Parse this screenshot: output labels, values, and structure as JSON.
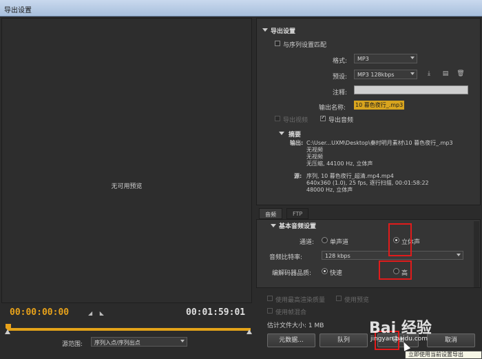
{
  "window": {
    "title": "导出设置"
  },
  "preview": {
    "no_preview": "无可用预览",
    "timecode_in": "00:00:00:00",
    "timecode_out": "00:01:59:01",
    "source_range_label": "源范围:",
    "source_range_value": "序列入点/序列出点"
  },
  "export_settings": {
    "header": "导出设置",
    "match_sequence_label": "与序列设置匹配",
    "format_label": "格式:",
    "format_value": "MP3",
    "preset_label": "预设:",
    "preset_value": "MP3 128kbps",
    "comment_label": "注释:",
    "comment_value": "",
    "output_name_label": "输出名称:",
    "output_name_value": "10 暮色夜行_.mp3",
    "export_video_label": "导出视频",
    "export_audio_label": "导出音频"
  },
  "summary": {
    "header": "摘要",
    "output_label": "输出:",
    "output_lines": [
      "C:\\User...UXM\\Desktop\\秦时明月素材\\10 暮色夜行_.mp3",
      "无视频",
      "无视频",
      "无压缩, 44100 Hz, 立体声"
    ],
    "source_label": "源:",
    "source_lines": [
      "序列, 10 暮色夜行_超清.mp4.mp4",
      "640x360 (1.0), 25 fps, 逐行扫描, 00:01:58:22",
      "48000 Hz, 立体声"
    ]
  },
  "tabs": [
    {
      "label": "音频"
    },
    {
      "label": "FTP"
    }
  ],
  "audio_settings": {
    "header": "基本音频设置",
    "channels_label": "通道:",
    "mono_label": "单声道",
    "stereo_label": "立体声",
    "bitrate_label": "音频比特率:",
    "bitrate_value": "128 kbps",
    "codec_quality_label": "编解码器品质:",
    "fast_label": "快速",
    "high_label": "高"
  },
  "bottom": {
    "max_render_quality_label": "使用最高渲染质量",
    "use_previews_label": "使用预览",
    "frame_blending_label": "使用帧混合",
    "estimated_size_label": "估计文件大小: 1 MB",
    "metadata_button": "元数据...",
    "queue_button": "队列",
    "export_button": "导出",
    "cancel_button": "取消",
    "tooltip": "立即使用当前设置导出"
  },
  "watermark": {
    "text": "Bai 经验",
    "sub": "jingyan.baidu.com"
  },
  "colors": {
    "accent": "#e8a21a",
    "highlight_box": "#e11b1b",
    "panel": "#333333"
  }
}
